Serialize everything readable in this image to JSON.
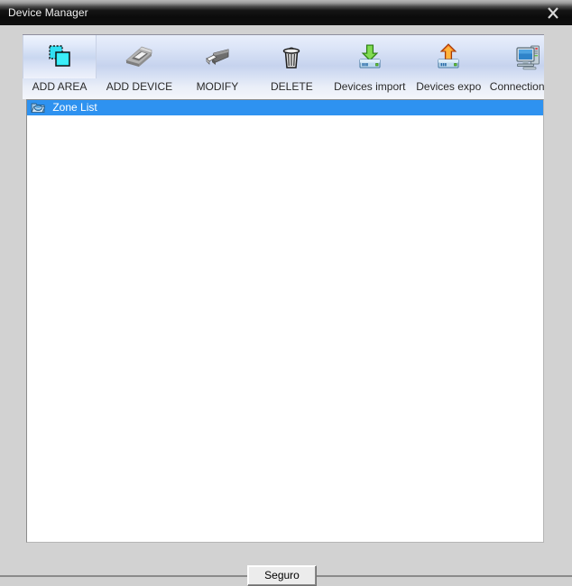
{
  "window": {
    "title": "Device Manager",
    "close_icon": "close-icon"
  },
  "toolbar": {
    "buttons": [
      {
        "label": "ADD AREA",
        "icon": "add-area-icon",
        "state": "hovered"
      },
      {
        "label": "ADD DEVICE",
        "icon": "add-device-icon",
        "state": "normal"
      },
      {
        "label": "MODIFY",
        "icon": "modify-icon",
        "state": "normal"
      },
      {
        "label": "DELETE",
        "icon": "delete-icon",
        "state": "normal"
      },
      {
        "label": "Devices import",
        "icon": "devices-import-icon",
        "state": "normal"
      },
      {
        "label": "Devices expo",
        "icon": "devices-export-icon",
        "state": "normal"
      },
      {
        "label": "Connection Test",
        "icon": "connection-test-icon",
        "state": "normal"
      }
    ]
  },
  "tree": {
    "rows": [
      {
        "label": "Zone List",
        "icon": "zone-list-icon",
        "selected": true
      }
    ]
  },
  "footer": {
    "ok_label": "Seguro"
  },
  "colors": {
    "selection": "#2e92f0",
    "titlebar": "#0b0b0b",
    "dialog_bg": "#d2d2d2",
    "panel_bg": "#ffffff"
  }
}
